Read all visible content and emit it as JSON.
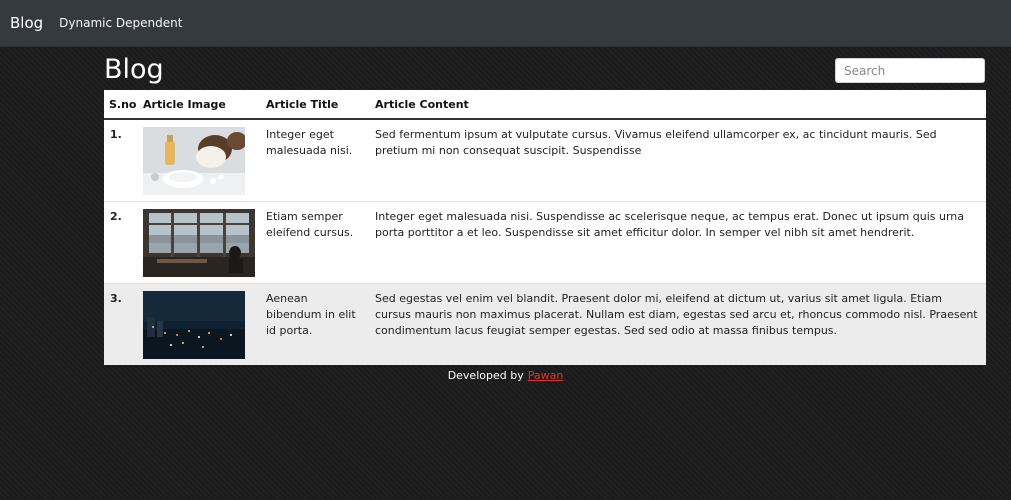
{
  "nav": {
    "brand": "Blog",
    "link": "Dynamic Dependent"
  },
  "page": {
    "title": "Blog"
  },
  "search": {
    "placeholder": "Search"
  },
  "table": {
    "headers": [
      "S.no",
      "Article Image",
      "Article Title",
      "Article Content"
    ],
    "rows": [
      {
        "sno": "1.",
        "image": "coconut-products-photo",
        "title": "Integer eget malesuada nisi.",
        "content": "Sed fermentum ipsum at vulputate cursus. Vivamus eleifend ullamcorper ex, ac tincidunt mauris. Sed pretium mi non consequat suscipit. Suspendisse"
      },
      {
        "sno": "2.",
        "image": "office-window-photo",
        "title": "Etiam semper eleifend cursus.",
        "content": "Integer eget malesuada nisi. Suspendisse ac scelerisque neque, ac tempus erat. Donec ut ipsum quis urna porta porttitor a et leo. Suspendisse sit amet efficitur dolor. In semper vel nibh sit amet hendrerit."
      },
      {
        "sno": "3.",
        "image": "night-city-photo",
        "title": "Aenean bibendum in elit id porta.",
        "content": "Sed egestas vel enim vel blandit. Praesent dolor mi, eleifend at dictum ut, varius sit amet ligula. Etiam cursus mauris non maximus placerat. Nullam est diam, egestas sed arcu et, rhoncus commodo nisl. Praesent condimentum lacus feugiat semper egestas. Sed sed odio at massa finibus tempus."
      }
    ]
  },
  "footer": {
    "text": "Developed by",
    "link": "Pawan"
  },
  "colors": {
    "background": "#1b1b1b",
    "navbar": "#343a40",
    "link_red": "#e0322e"
  }
}
